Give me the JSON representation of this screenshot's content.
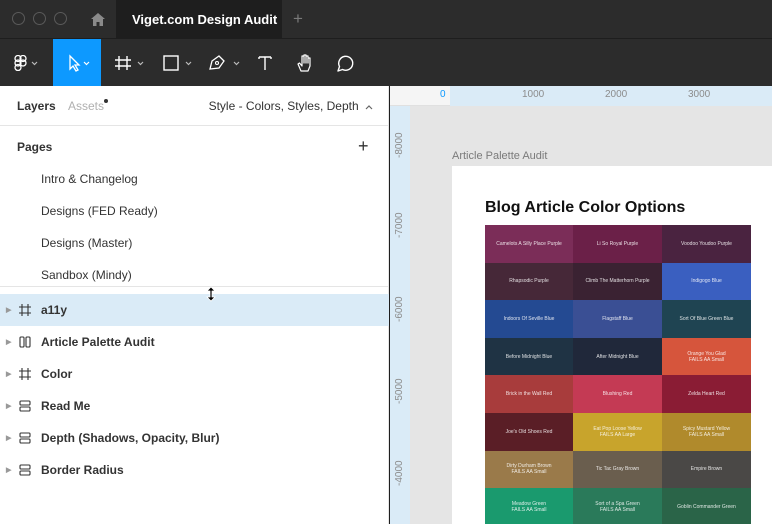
{
  "window": {
    "tab_title": "Viget.com Design Audit",
    "tab_add": "+"
  },
  "toolbar": {
    "tools": [
      "figma-menu-icon",
      "move-icon",
      "frame-icon",
      "rectangle-icon",
      "pen-icon",
      "text-icon",
      "hand-icon",
      "comment-icon"
    ],
    "active_tool": "move-icon",
    "accent_color": "#0d99ff"
  },
  "left_panel": {
    "tab_layers": "Layers",
    "tab_assets": "Assets",
    "page_picker": "Style - Colors, Styles, Depth",
    "pages_header": "Pages",
    "pages_add": "+",
    "pages": [
      "Intro & Changelog",
      "Designs (FED Ready)",
      "Designs (Master)",
      "Sandbox (Mindy)"
    ],
    "layers": [
      {
        "name": "a11y",
        "icon": "frame-icon",
        "selected": true
      },
      {
        "name": "Article Palette Audit",
        "icon": "columns-icon",
        "selected": false
      },
      {
        "name": "Color",
        "icon": "frame-icon",
        "selected": false
      },
      {
        "name": "Read Me",
        "icon": "rows-icon",
        "selected": false
      },
      {
        "name": "Depth (Shadows, Opacity, Blur)",
        "icon": "rows-icon",
        "selected": false
      },
      {
        "name": "Border Radius",
        "icon": "rows-icon",
        "selected": false
      }
    ]
  },
  "canvas": {
    "ruler_top": [
      "0",
      "1000",
      "2000",
      "3000"
    ],
    "ruler_left": [
      "-8000",
      "-7000",
      "-6000",
      "-5000",
      "-4000"
    ],
    "frame_label": "Article Palette Audit",
    "frame_title": "Blog Article Color Options",
    "swatches": [
      {
        "label": "Camelots A Silly Place Purple",
        "color": "#7b2d58"
      },
      {
        "label": "Li So Royal Purple",
        "color": "#6b2048"
      },
      {
        "label": "Voodoo Youdoo Purple",
        "color": "#4a2340"
      },
      {
        "label": "Rhapsodic Purple",
        "color": "#462838"
      },
      {
        "label": "Climb The Matterhorn Purple",
        "color": "#3a2232"
      },
      {
        "label": "Indigogo Blue",
        "color": "#3a5fc0"
      },
      {
        "label": "Indoors Of Seville Blue",
        "color": "#244a92"
      },
      {
        "label": "Flagstaff Blue",
        "color": "#3a4f94"
      },
      {
        "label": "Sort Of Blue Green Blue",
        "color": "#1f4452"
      },
      {
        "label": "Before Midnight Blue",
        "color": "#1f3344"
      },
      {
        "label": "After Midnight Blue",
        "color": "#20283a"
      },
      {
        "label": "Orange You Glad\nFAILS AA Small",
        "color": "#d6553c"
      },
      {
        "label": "Brick in the Wall Red",
        "color": "#a83c3c"
      },
      {
        "label": "Blushing Red",
        "color": "#c43a54"
      },
      {
        "label": "Zelda Heart Red",
        "color": "#8a1c34"
      },
      {
        "label": "Joe's Old Shoes Red",
        "color": "#5a1e26"
      },
      {
        "label": "Eat Pop Loose Yellow\nFAILS AA Large",
        "color": "#c8a42c"
      },
      {
        "label": "Spicy Mustard Yellow\nFAILS AA Small",
        "color": "#b08a2c"
      },
      {
        "label": "Dirty Durham Brown\nFAILS AA Small",
        "color": "#9a7a4a"
      },
      {
        "label": "Tic Tac Gray Brown",
        "color": "#6a5e4e"
      },
      {
        "label": "Empire Brown",
        "color": "#4a4846"
      },
      {
        "label": "Meadow Green\nFAILS AA Small",
        "color": "#1a9a6e"
      },
      {
        "label": "Sort of a Spa Green\nFAILS AA Small",
        "color": "#2a7a5a"
      },
      {
        "label": "Goblin Commander Green",
        "color": "#2a6448"
      }
    ]
  }
}
